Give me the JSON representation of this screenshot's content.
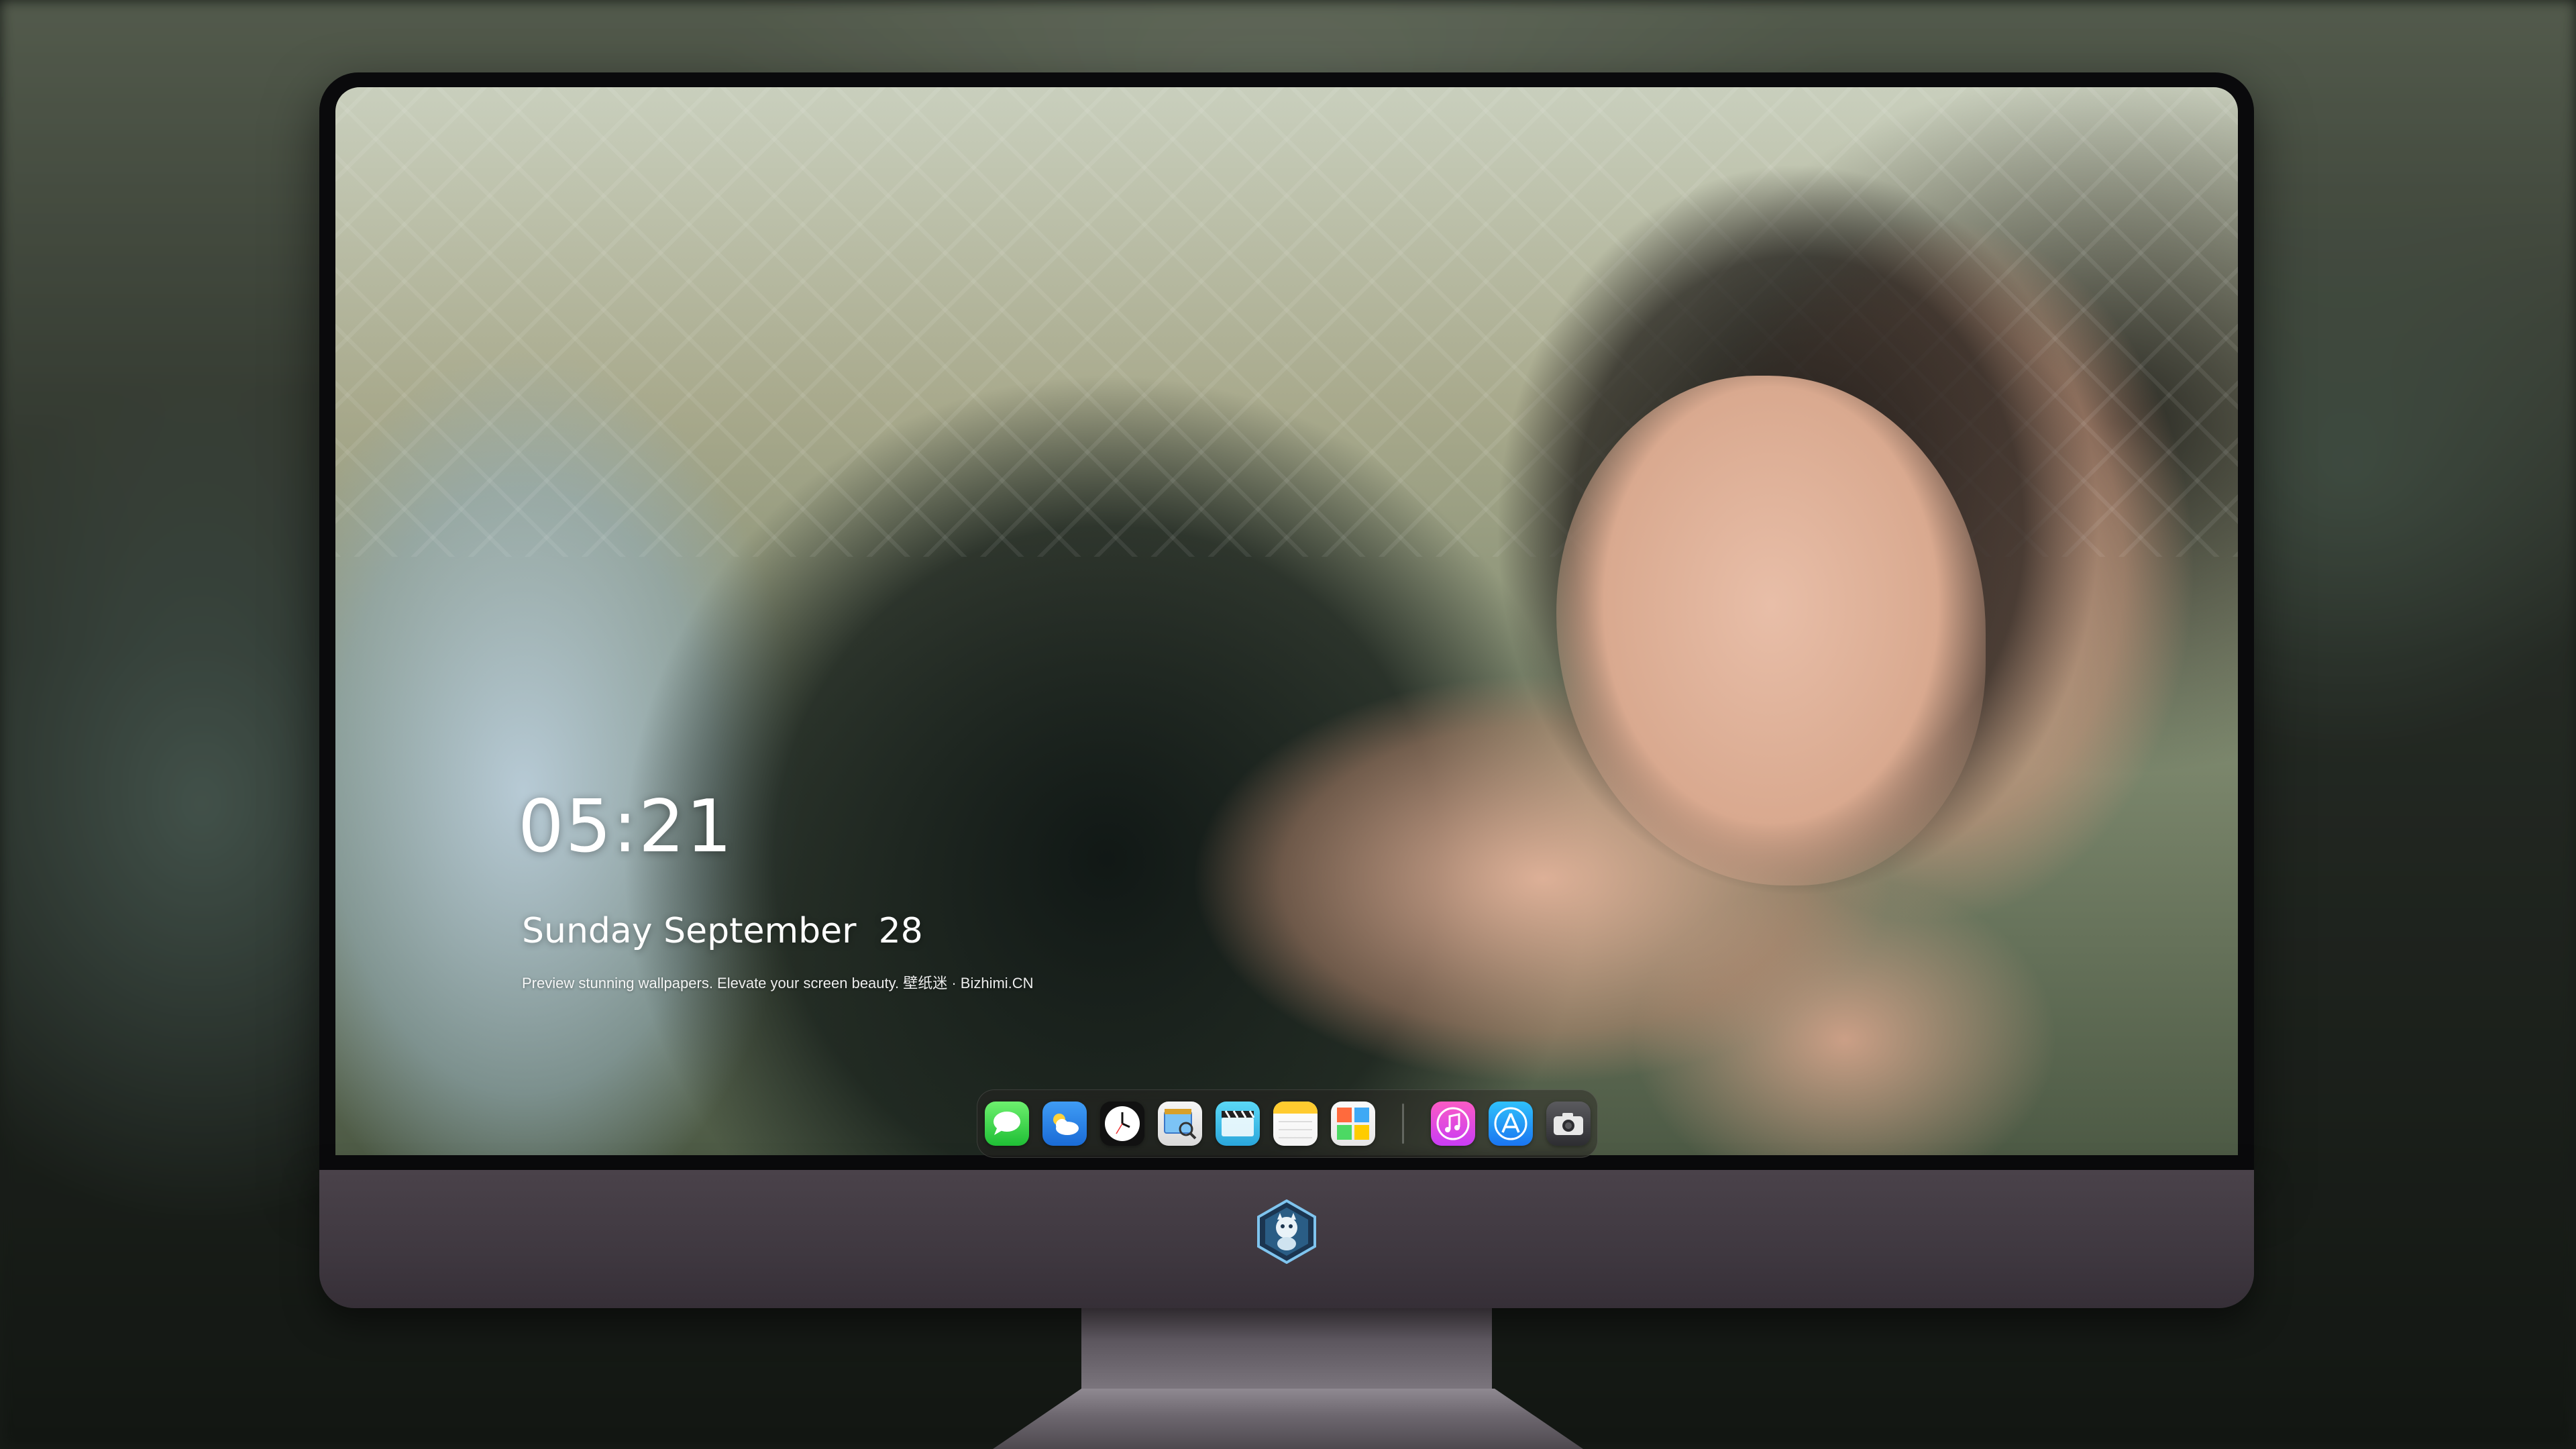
{
  "lock_screen": {
    "time": "05:21",
    "date": "Sunday September  28",
    "note": "Preview stunning wallpapers. Elevate your screen beauty. 壁纸迷 · Bizhimi.CN"
  },
  "dock": {
    "apps": [
      {
        "name": "messages",
        "icon": "messages-icon"
      },
      {
        "name": "weather",
        "icon": "weather-icon"
      },
      {
        "name": "clock",
        "icon": "clock-icon"
      },
      {
        "name": "preview",
        "icon": "preview-icon"
      },
      {
        "name": "clips",
        "icon": "clips-icon"
      },
      {
        "name": "notes",
        "icon": "notes-icon"
      },
      {
        "name": "photos",
        "icon": "photos-icon"
      },
      {
        "name": "music",
        "icon": "music-icon"
      },
      {
        "name": "app store",
        "icon": "app-store-icon"
      },
      {
        "name": "camera",
        "icon": "camera-icon"
      }
    ]
  },
  "colors": {
    "monitor_chin": "#3f3840",
    "bezel": "#0a0a0c",
    "text": "#ffffff"
  }
}
